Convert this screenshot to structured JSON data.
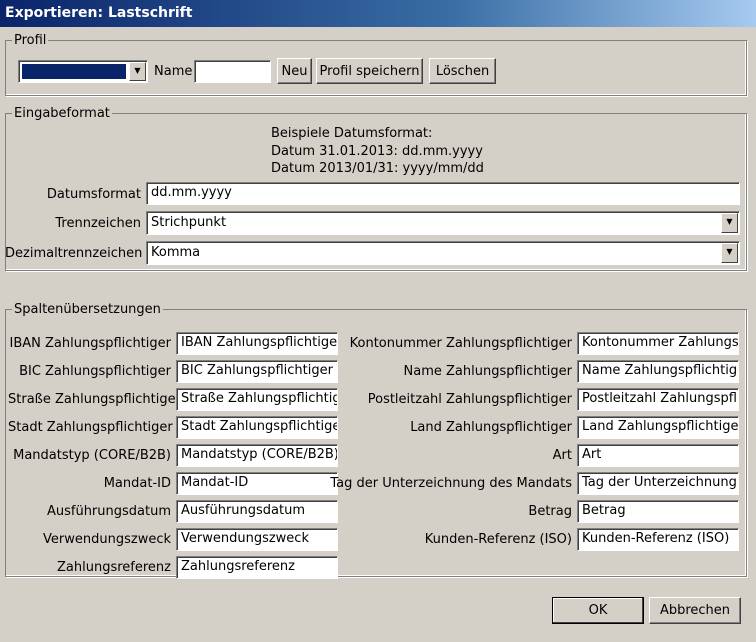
{
  "window": {
    "title": "Exportieren: Lastschrift"
  },
  "profil": {
    "legend": "Profil",
    "name_label": "Name",
    "name_value": "",
    "btn_neu": "Neu",
    "btn_save": "Profil speichern",
    "btn_delete": "Löschen",
    "selection_color": "#0a246a"
  },
  "eingabe": {
    "legend": "Eingabeformat",
    "example_title": "Beispiele Datumsformat:",
    "example_1": "Datum 31.01.2013: dd.mm.yyyy",
    "example_2": "Datum 2013/01/31: yyyy/mm/dd",
    "datumsformat_label": "Datumsformat",
    "datumsformat_value": "dd.mm.yyyy",
    "trennzeichen_label": "Trennzeichen",
    "trennzeichen_value": "Strichpunkt",
    "dezimal_label": "Dezimaltrennzeichen",
    "dezimal_value": "Komma"
  },
  "spalten": {
    "legend": "Spaltenübersetzungen",
    "left": [
      {
        "label": "IBAN Zahlungspflichtiger",
        "value": "IBAN Zahlungspflichtiger"
      },
      {
        "label": "BIC Zahlungspflichtiger",
        "value": "BIC Zahlungspflichtiger"
      },
      {
        "label": "Straße Zahlungspflichtiger",
        "value": "Straße Zahlungspflichtiger"
      },
      {
        "label": "Stadt Zahlungspflichtiger",
        "value": "Stadt Zahlungspflichtiger"
      },
      {
        "label": "Mandatstyp (CORE/B2B)",
        "value": "Mandatstyp (CORE/B2B)"
      },
      {
        "label": "Mandat-ID",
        "value": "Mandat-ID"
      },
      {
        "label": "Ausführungsdatum",
        "value": "Ausführungsdatum"
      },
      {
        "label": "Verwendungszweck",
        "value": "Verwendungszweck"
      },
      {
        "label": "Zahlungsreferenz",
        "value": "Zahlungsreferenz"
      }
    ],
    "right": [
      {
        "label": "Kontonummer Zahlungspflichtiger",
        "value": "Kontonummer Zahlungspflichtiger"
      },
      {
        "label": "Name Zahlungspflichtiger",
        "value": "Name Zahlungspflichtiger"
      },
      {
        "label": "Postleitzahl Zahlungspflichtiger",
        "value": "Postleitzahl Zahlungspflichtiger"
      },
      {
        "label": "Land Zahlungspflichtiger",
        "value": "Land Zahlungspflichtiger"
      },
      {
        "label": "Art",
        "value": "Art"
      },
      {
        "label": "Tag der Unterzeichnung des Mandats",
        "value": "Tag der Unterzeichnung des Mandats"
      },
      {
        "label": "Betrag",
        "value": "Betrag"
      },
      {
        "label": "Kunden-Referenz (ISO)",
        "value": "Kunden-Referenz (ISO)"
      }
    ]
  },
  "footer": {
    "ok": "OK",
    "cancel": "Abbrechen"
  }
}
